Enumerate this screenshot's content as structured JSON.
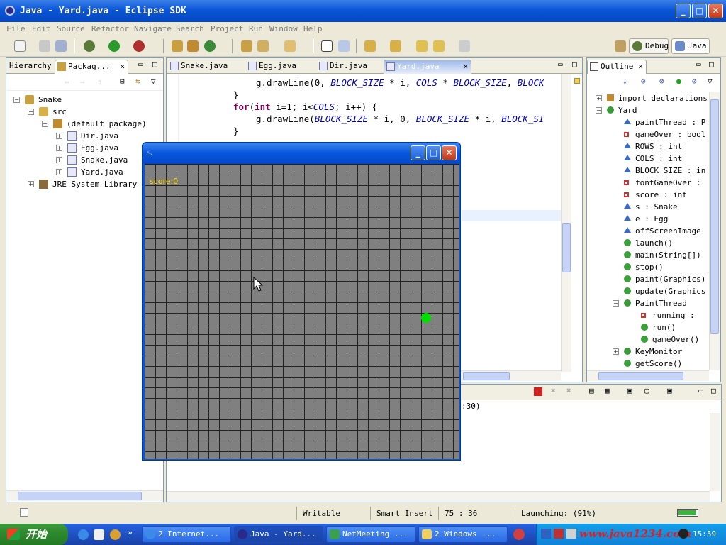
{
  "window": {
    "title": "Java - Yard.java - Eclipse SDK"
  },
  "menu": [
    "File",
    "Edit",
    "Source",
    "Refactor",
    "Navigate",
    "Search",
    "Project",
    "Run",
    "Window",
    "Help"
  ],
  "perspectives": {
    "debug": "Debug",
    "java": "Java"
  },
  "left_panel": {
    "tabs": [
      "Hierarchy",
      "Packag..."
    ],
    "tree": {
      "project": "Snake",
      "src": "src",
      "package": "(default package)",
      "files": [
        "Dir.java",
        "Egg.java",
        "Snake.java",
        "Yard.java"
      ],
      "library": "JRE System Library [j"
    }
  },
  "editor": {
    "tabs": [
      "Snake.java",
      "Egg.java",
      "Dir.java",
      "Yard.java"
    ],
    "active_tab": "Yard.java",
    "lines": [
      {
        "a": "g.drawLine(0, ",
        "c1": "BLOCK_SIZE",
        "b": " * i, ",
        "c2": "COLS",
        "d": " * ",
        "c3": "BLOCK_SIZE",
        "e": ", ",
        "c4": "BLOCK"
      },
      {
        "a": "}"
      },
      {
        "kw1": "for",
        "a1": "(",
        "kw2": "int",
        "a2": " i=1; i<",
        "c1": "COLS",
        "a3": "; i++) {"
      },
      {
        "a": "g.drawLine(",
        "c1": "BLOCK_SIZE",
        "b": " * i, 0, ",
        "c2": "BLOCK_SIZE",
        "d": " * i, ",
        "c3": "BLOCK_SI"
      },
      {
        "a": "}"
      }
    ]
  },
  "console": {
    "text": ":30)"
  },
  "snake_game": {
    "score_label": "score:0",
    "grid_cols": 30,
    "grid_rows": 28,
    "egg_color": "#00e000",
    "egg_col": 26,
    "egg_row": 14
  },
  "outline": {
    "tab": "Outline",
    "items": [
      {
        "label": "import declarations",
        "kind": "import"
      },
      {
        "label": "Yard",
        "kind": "class"
      },
      {
        "label": "paintThread : P",
        "kind": "field-default"
      },
      {
        "label": "gameOver : bool",
        "kind": "field-private"
      },
      {
        "label": "ROWS : int",
        "kind": "field-static"
      },
      {
        "label": "COLS : int",
        "kind": "field-static"
      },
      {
        "label": "BLOCK_SIZE : in",
        "kind": "field-static"
      },
      {
        "label": "fontGameOver :",
        "kind": "field-private"
      },
      {
        "label": "score : int",
        "kind": "field-private"
      },
      {
        "label": "s : Snake",
        "kind": "field-default"
      },
      {
        "label": "e : Egg",
        "kind": "field-default"
      },
      {
        "label": "offScreenImage",
        "kind": "field-default"
      },
      {
        "label": "launch()",
        "kind": "method"
      },
      {
        "label": "main(String[])",
        "kind": "method-static"
      },
      {
        "label": "stop()",
        "kind": "method"
      },
      {
        "label": "paint(Graphics)",
        "kind": "method-override"
      },
      {
        "label": "update(Graphics",
        "kind": "method-override"
      },
      {
        "label": "PaintThread",
        "kind": "inner-class"
      },
      {
        "label": "running : ",
        "kind": "field-private"
      },
      {
        "label": "run()",
        "kind": "method-override"
      },
      {
        "label": "gameOver()",
        "kind": "method"
      },
      {
        "label": "KeyMonitor",
        "kind": "inner-class"
      },
      {
        "label": "getScore()",
        "kind": "method"
      }
    ]
  },
  "status": {
    "writable": "Writable",
    "insert": "Smart Insert",
    "position": "75 : 36",
    "launching": "Launching: (91%)"
  },
  "taskbar": {
    "start": "开始",
    "items": [
      "2 Internet...",
      "Java - Yard...",
      "NetMeeting ...",
      "2 Windows ..."
    ],
    "tray_text": "www.java1234.com",
    "clock": "15:59"
  },
  "colors": {
    "xp_blue": "#0a56d8",
    "code_keyword": "#7f0055",
    "code_constant": "#0000c0",
    "score_text": "#ffd800"
  }
}
